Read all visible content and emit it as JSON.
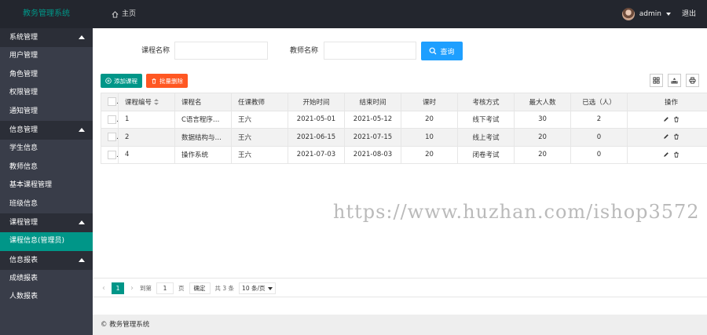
{
  "header": {
    "brand": "教务管理系统",
    "home_label": "主页",
    "user_name": "admin",
    "logout_label": "退出"
  },
  "sidebar": {
    "groups": [
      {
        "label": "系统管理",
        "items": [
          "用户管理",
          "角色管理",
          "权限管理",
          "通知管理"
        ]
      },
      {
        "label": "信息管理",
        "items": [
          "学生信息",
          "教师信息",
          "基本课程管理",
          "班级信息"
        ]
      },
      {
        "label": "课程管理",
        "items": [
          "课程信息(管理员)"
        ]
      },
      {
        "label": "信息报表",
        "items": [
          "成绩报表",
          "人数报表"
        ]
      }
    ]
  },
  "search": {
    "course_label": "课程名称",
    "teacher_label": "教师名称",
    "course_value": "",
    "teacher_value": "",
    "query_label": "查询"
  },
  "toolbar": {
    "add_label": "添加课程",
    "batch_delete_label": "批量删除"
  },
  "table": {
    "headers": [
      "课程编号",
      "课程名",
      "任课教师",
      "开始时间",
      "结束时间",
      "课时",
      "考核方式",
      "最大人数",
      "已选（人）",
      "操作"
    ],
    "rows": [
      [
        "1",
        "C语言程序…",
        "王六",
        "2021-05-01",
        "2021-05-12",
        "20",
        "线下考试",
        "30",
        "2"
      ],
      [
        "2",
        "数据结构与…",
        "王六",
        "2021-06-15",
        "2021-07-15",
        "10",
        "线上考试",
        "20",
        "0"
      ],
      [
        "4",
        "操作系统",
        "王六",
        "2021-07-03",
        "2021-08-03",
        "20",
        "闭卷考试",
        "20",
        "0"
      ]
    ]
  },
  "pager": {
    "current_page": "1",
    "goto_label": "到第",
    "goto_value": "1",
    "page_unit": "页",
    "confirm_label": "确定",
    "total_label": "共 3 条",
    "page_size_label": "10 条/页"
  },
  "watermark": "https://www.huzhan.com/ishop3572",
  "footer": {
    "text": "© 教务管理系统"
  },
  "colors": {
    "accent": "#009688",
    "query": "#1e9fff",
    "danger": "#ff5722",
    "header_bg": "#23262e",
    "sidebar_bg": "#393d49"
  }
}
